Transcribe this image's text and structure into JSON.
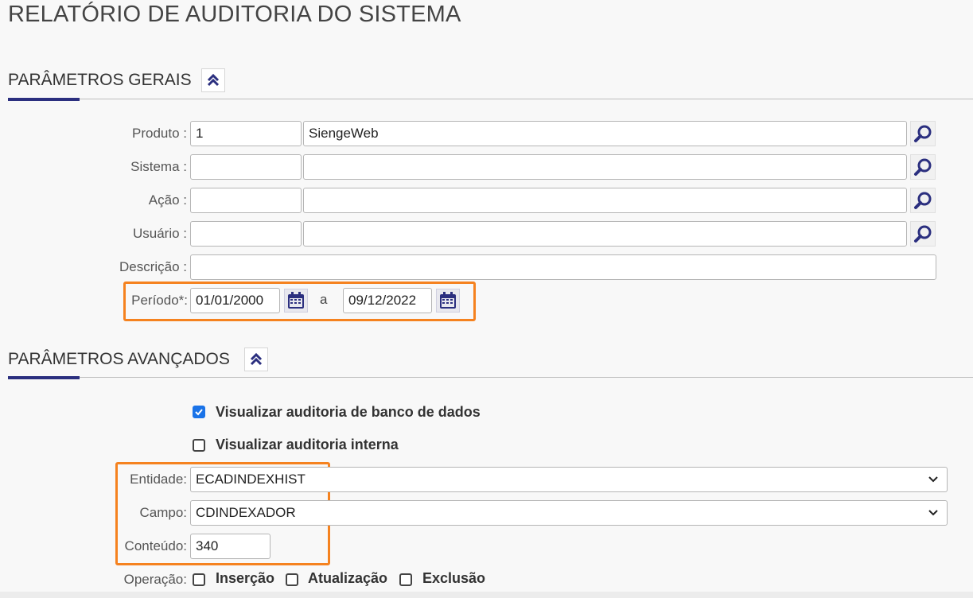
{
  "page": {
    "title": "RELATÓRIO DE AUDITORIA DO SISTEMA"
  },
  "general": {
    "title": "PARÂMETROS GERAIS",
    "fields": {
      "produto": {
        "label": "Produto :",
        "code": "1",
        "name": "SiengeWeb"
      },
      "sistema": {
        "label": "Sistema :",
        "code": "",
        "name": ""
      },
      "acao": {
        "label": "Ação :",
        "code": "",
        "name": ""
      },
      "usuario": {
        "label": "Usuário :",
        "code": "",
        "name": ""
      },
      "descricao": {
        "label": "Descrição :",
        "value": ""
      },
      "periodo": {
        "label": "Período*:",
        "start": "01/01/2000",
        "separator": "a",
        "end": "09/12/2022"
      }
    }
  },
  "advanced": {
    "title": "PARÂMETROS AVANÇADOS",
    "checkboxes": {
      "db_audit": {
        "label": "Visualizar auditoria de banco de dados",
        "checked": true
      },
      "internal_audit": {
        "label": "Visualizar auditoria interna",
        "checked": false
      }
    },
    "entidade": {
      "label": "Entidade:",
      "value": "ECADINDEXHIST"
    },
    "campo": {
      "label": "Campo:",
      "value": "CDINDEXADOR"
    },
    "conteudo": {
      "label": "Conteúdo:",
      "value": "340"
    },
    "operacao": {
      "label": "Operação:",
      "options": [
        {
          "label": "Inserção",
          "checked": false
        },
        {
          "label": "Atualização",
          "checked": false
        },
        {
          "label": "Exclusão",
          "checked": false
        }
      ]
    }
  },
  "colors": {
    "accent": "#2b2f7f",
    "highlight": "#f5821f",
    "checkbox_checked": "#1a73e8"
  },
  "icons": {
    "collapse": "double-chevron-up-icon",
    "lookup": "magnifier-icon",
    "calendar": "calendar-icon",
    "select": "chevron-down-icon"
  }
}
